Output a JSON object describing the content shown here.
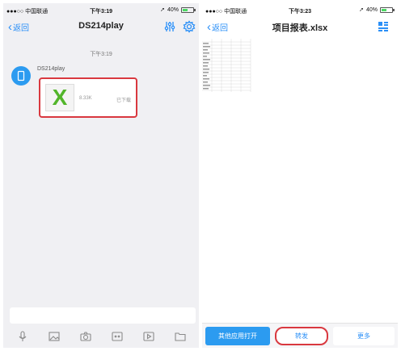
{
  "left": {
    "status": {
      "carrier": "●●●○○ 中国联通",
      "time": "下午3:19",
      "battery": "40%"
    },
    "nav": {
      "back": "返回",
      "title": "DS214play"
    },
    "message": {
      "time": "下午3:19",
      "sender": "DS214play",
      "file": {
        "icon_letter": "X",
        "size": "8.33K",
        "status": "已下载"
      }
    },
    "toolbar": {
      "icons": [
        "mic-icon",
        "image-icon",
        "camera-icon",
        "video-chat-icon",
        "video-icon",
        "folder-icon"
      ]
    }
  },
  "right": {
    "status": {
      "carrier": "●●●○○ 中国联通",
      "time": "下午3:23",
      "battery": "40%"
    },
    "nav": {
      "back": "返回",
      "title": "项目报表.xlsx"
    },
    "actions": {
      "open_with": "其他应用打开",
      "forward": "转发",
      "more": "更多"
    }
  },
  "colors": {
    "accent": "#2c9bf0",
    "highlight": "#d9383f",
    "excel_green": "#52b52a",
    "chat_bg": "#f0f0f3"
  }
}
